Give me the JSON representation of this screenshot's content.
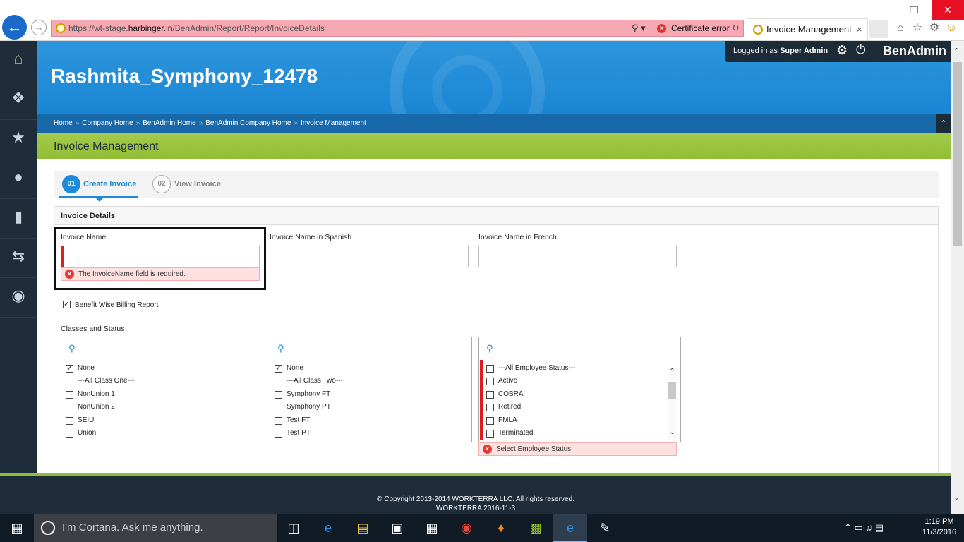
{
  "browser": {
    "url_prefix": "https://wt-stage.",
    "url_domain": "harbinger.in",
    "url_path": "/BenAdmin/Report/Report/InvoiceDetails",
    "certificate_error": "Certificate error",
    "tab_title": "Invoice Management",
    "tab_close": "×",
    "search_icon": "search-icon",
    "back_icon": "back-arrow-icon"
  },
  "header": {
    "company_name": "Rashmita_Symphony_12478",
    "logged_in_prefix": "Logged in as ",
    "logged_in_user": "Super Admin",
    "brand": "BenAdmin"
  },
  "breadcrumb": [
    "Home",
    "Company Home",
    "BenAdmin Home",
    "BenAdmin Company Home",
    "Invoice Management"
  ],
  "breadcrumb_sep": "»",
  "page_title": "Invoice Management",
  "steps": [
    {
      "num": "01",
      "label": "Create Invoice"
    },
    {
      "num": "02",
      "label": "View Invoice"
    }
  ],
  "panel_title": "Invoice Details",
  "fields": {
    "invoice_name": {
      "label": "Invoice Name",
      "value": "",
      "error": "The InvoiceName field is required."
    },
    "invoice_name_spanish": {
      "label": "Invoice Name in Spanish",
      "value": ""
    },
    "invoice_name_french": {
      "label": "Invoice Name in French",
      "value": ""
    }
  },
  "benefit_wise": {
    "label": "Benefit Wise Billing Report",
    "checked": true
  },
  "classes_label": "Classes and Status",
  "class_one_list": [
    {
      "label": "None",
      "checked": true
    },
    {
      "label": "---All Class One---",
      "checked": false
    },
    {
      "label": "NonUnion 1",
      "checked": false
    },
    {
      "label": "NonUnion 2",
      "checked": false
    },
    {
      "label": "SEIU",
      "checked": false
    },
    {
      "label": "Union",
      "checked": false
    }
  ],
  "class_two_list": [
    {
      "label": "None",
      "checked": true
    },
    {
      "label": "---All Class Two---",
      "checked": false
    },
    {
      "label": "Symphony FT",
      "checked": false
    },
    {
      "label": "Symphony PT",
      "checked": false
    },
    {
      "label": "Test FT",
      "checked": false
    },
    {
      "label": "Test PT",
      "checked": false
    }
  ],
  "status_list": [
    {
      "label": "---All Employee Status---",
      "checked": false
    },
    {
      "label": "Active",
      "checked": false
    },
    {
      "label": "COBRA",
      "checked": false
    },
    {
      "label": "Retired",
      "checked": false
    },
    {
      "label": "FMLA",
      "checked": false
    },
    {
      "label": "Terminated",
      "checked": false
    }
  ],
  "status_error": "Select Employee Status",
  "footer": {
    "copyright": "© Copyright 2013-2014 WORKTERRA LLC. All rights reserved.",
    "version": "WORKTERRA 2016-11-3"
  },
  "taskbar": {
    "cortana": "I'm Cortana. Ask me anything.",
    "time": "1:19 PM",
    "date": "11/3/2016"
  },
  "colors": {
    "header_blue": "#1a86d4",
    "title_green": "#8fbd35",
    "sidebar_dark": "#1f2d3a",
    "error_red": "#e01c1c",
    "accent_blue": "#1f8ad8"
  }
}
